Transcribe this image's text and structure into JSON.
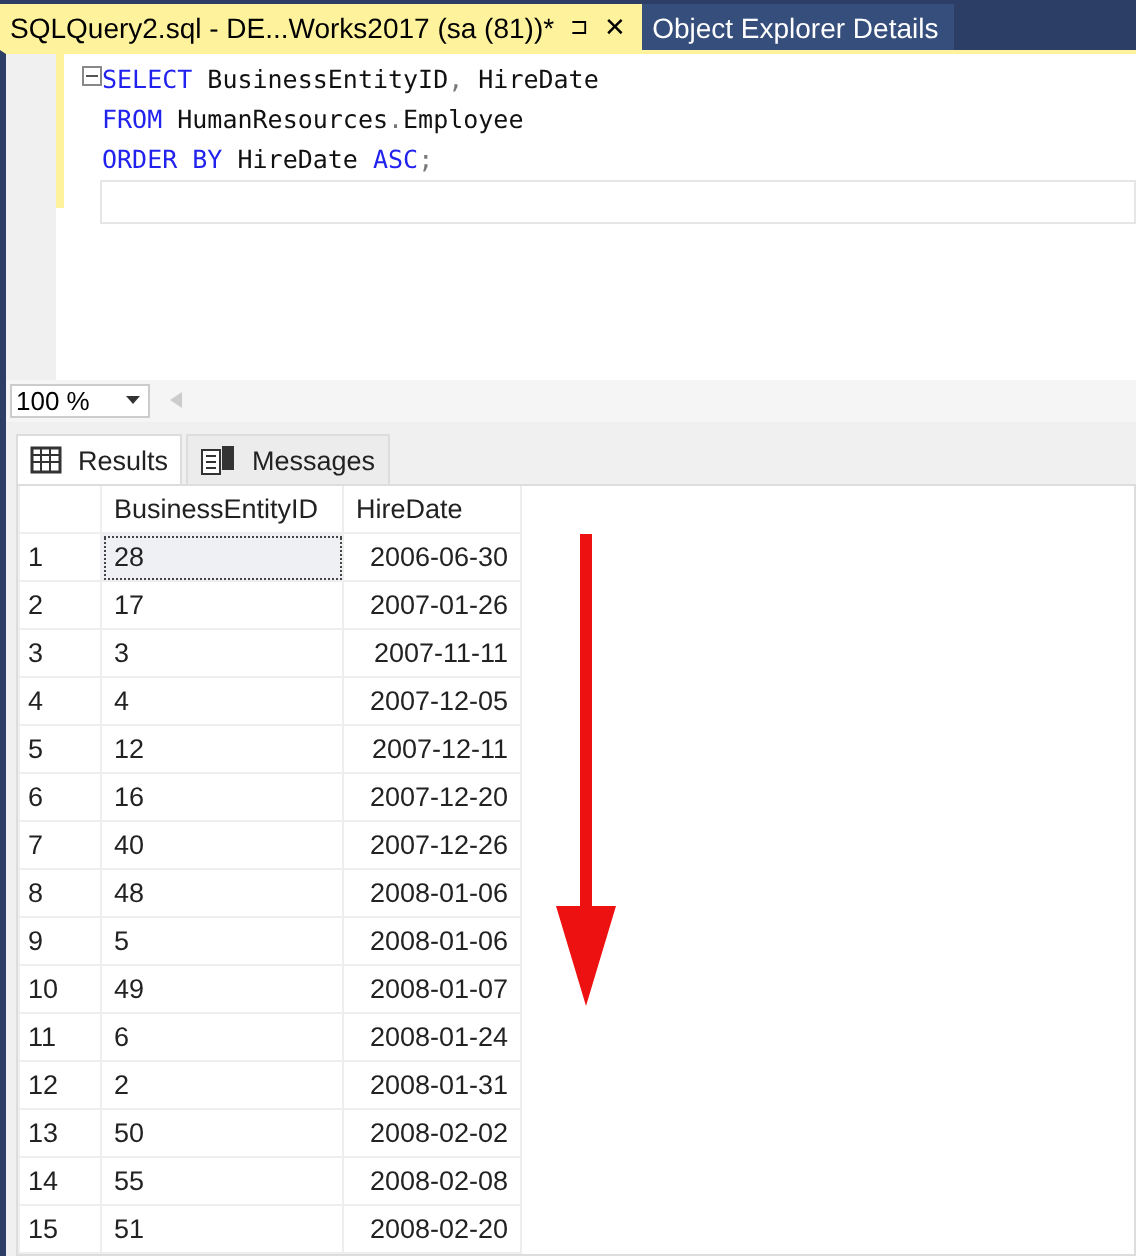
{
  "document_tabs": [
    {
      "label": "SQLQuery2.sql - DE...Works2017 (sa (81))*",
      "selected": true,
      "pin": "⊐",
      "close": "✕"
    },
    {
      "label": "Object Explorer Details",
      "selected": false
    }
  ],
  "editor": {
    "lines": [
      {
        "tokens": [
          {
            "kind": "keyword",
            "text": "SELECT"
          },
          {
            "kind": "plain",
            "text": " BusinessEntityID"
          },
          {
            "kind": "punct",
            "text": ","
          },
          {
            "kind": "plain",
            "text": " HireDate"
          }
        ]
      },
      {
        "tokens": [
          {
            "kind": "keyword",
            "text": "FROM"
          },
          {
            "kind": "plain",
            "text": " HumanResources"
          },
          {
            "kind": "punct",
            "text": "."
          },
          {
            "kind": "plain",
            "text": "Employee"
          }
        ]
      },
      {
        "tokens": [
          {
            "kind": "keyword",
            "text": "ORDER BY"
          },
          {
            "kind": "plain",
            "text": " HireDate "
          },
          {
            "kind": "keyword",
            "text": "ASC"
          },
          {
            "kind": "punct",
            "text": ";"
          }
        ]
      }
    ]
  },
  "zoom": {
    "value": "100 %"
  },
  "result_tabs": [
    {
      "label": "Results",
      "selected": true
    },
    {
      "label": "Messages",
      "selected": false
    }
  ],
  "grid": {
    "columns": [
      "BusinessEntityID",
      "HireDate"
    ],
    "rows": [
      {
        "num": "1",
        "cells": [
          "28",
          "2006-06-30"
        ],
        "selected": true
      },
      {
        "num": "2",
        "cells": [
          "17",
          "2007-01-26"
        ],
        "selected": false
      },
      {
        "num": "3",
        "cells": [
          "3",
          "2007-11-11"
        ],
        "selected": false
      },
      {
        "num": "4",
        "cells": [
          "4",
          "2007-12-05"
        ],
        "selected": false
      },
      {
        "num": "5",
        "cells": [
          "12",
          "2007-12-11"
        ],
        "selected": false
      },
      {
        "num": "6",
        "cells": [
          "16",
          "2007-12-20"
        ],
        "selected": false
      },
      {
        "num": "7",
        "cells": [
          "40",
          "2007-12-26"
        ],
        "selected": false
      },
      {
        "num": "8",
        "cells": [
          "48",
          "2008-01-06"
        ],
        "selected": false
      },
      {
        "num": "9",
        "cells": [
          "5",
          "2008-01-06"
        ],
        "selected": false
      },
      {
        "num": "10",
        "cells": [
          "49",
          "2008-01-07"
        ],
        "selected": false
      },
      {
        "num": "11",
        "cells": [
          "6",
          "2008-01-24"
        ],
        "selected": false
      },
      {
        "num": "12",
        "cells": [
          "2",
          "2008-01-31"
        ],
        "selected": false
      },
      {
        "num": "13",
        "cells": [
          "50",
          "2008-02-02"
        ],
        "selected": false
      },
      {
        "num": "14",
        "cells": [
          "55",
          "2008-02-08"
        ],
        "selected": false
      },
      {
        "num": "15",
        "cells": [
          "51",
          "2008-02-20"
        ],
        "selected": false
      }
    ]
  }
}
